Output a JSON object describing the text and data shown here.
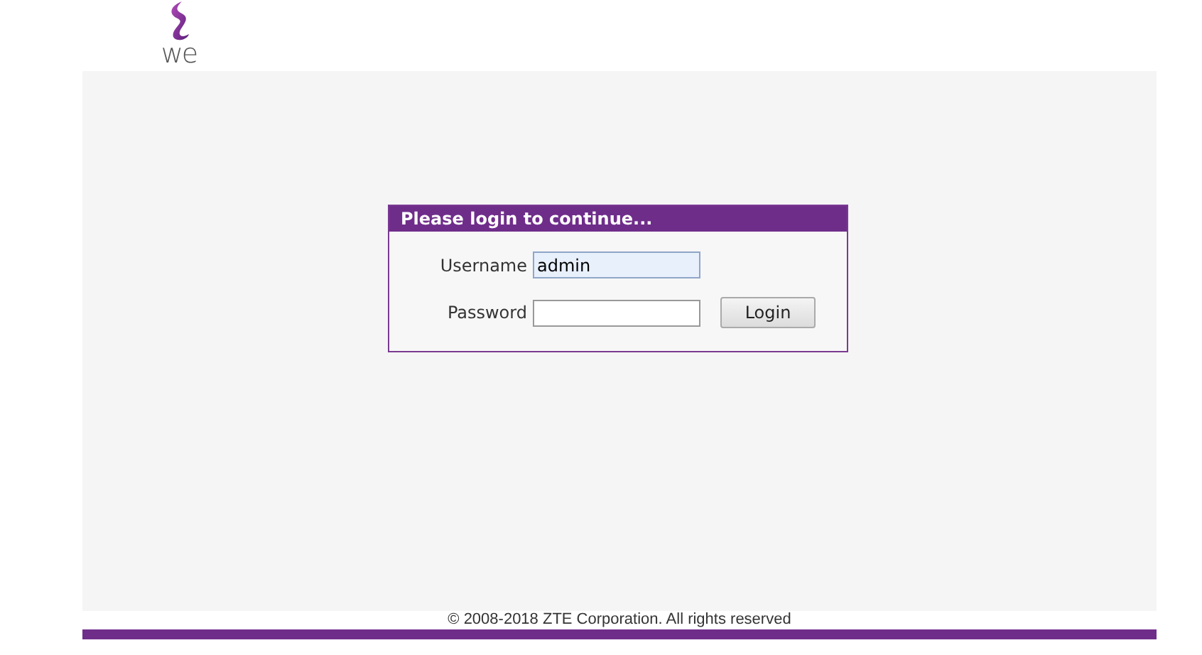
{
  "logo": {
    "text": "we"
  },
  "login": {
    "title": "Please login to continue...",
    "fields": [
      {
        "label": "Username",
        "value": "admin",
        "kind": "text",
        "focused": true
      },
      {
        "label": "Password",
        "kind": "password",
        "focused": false
      }
    ],
    "button": "Login"
  },
  "footer": {
    "copyright": "© 2008-2018 ZTE Corporation. All rights reserved"
  }
}
